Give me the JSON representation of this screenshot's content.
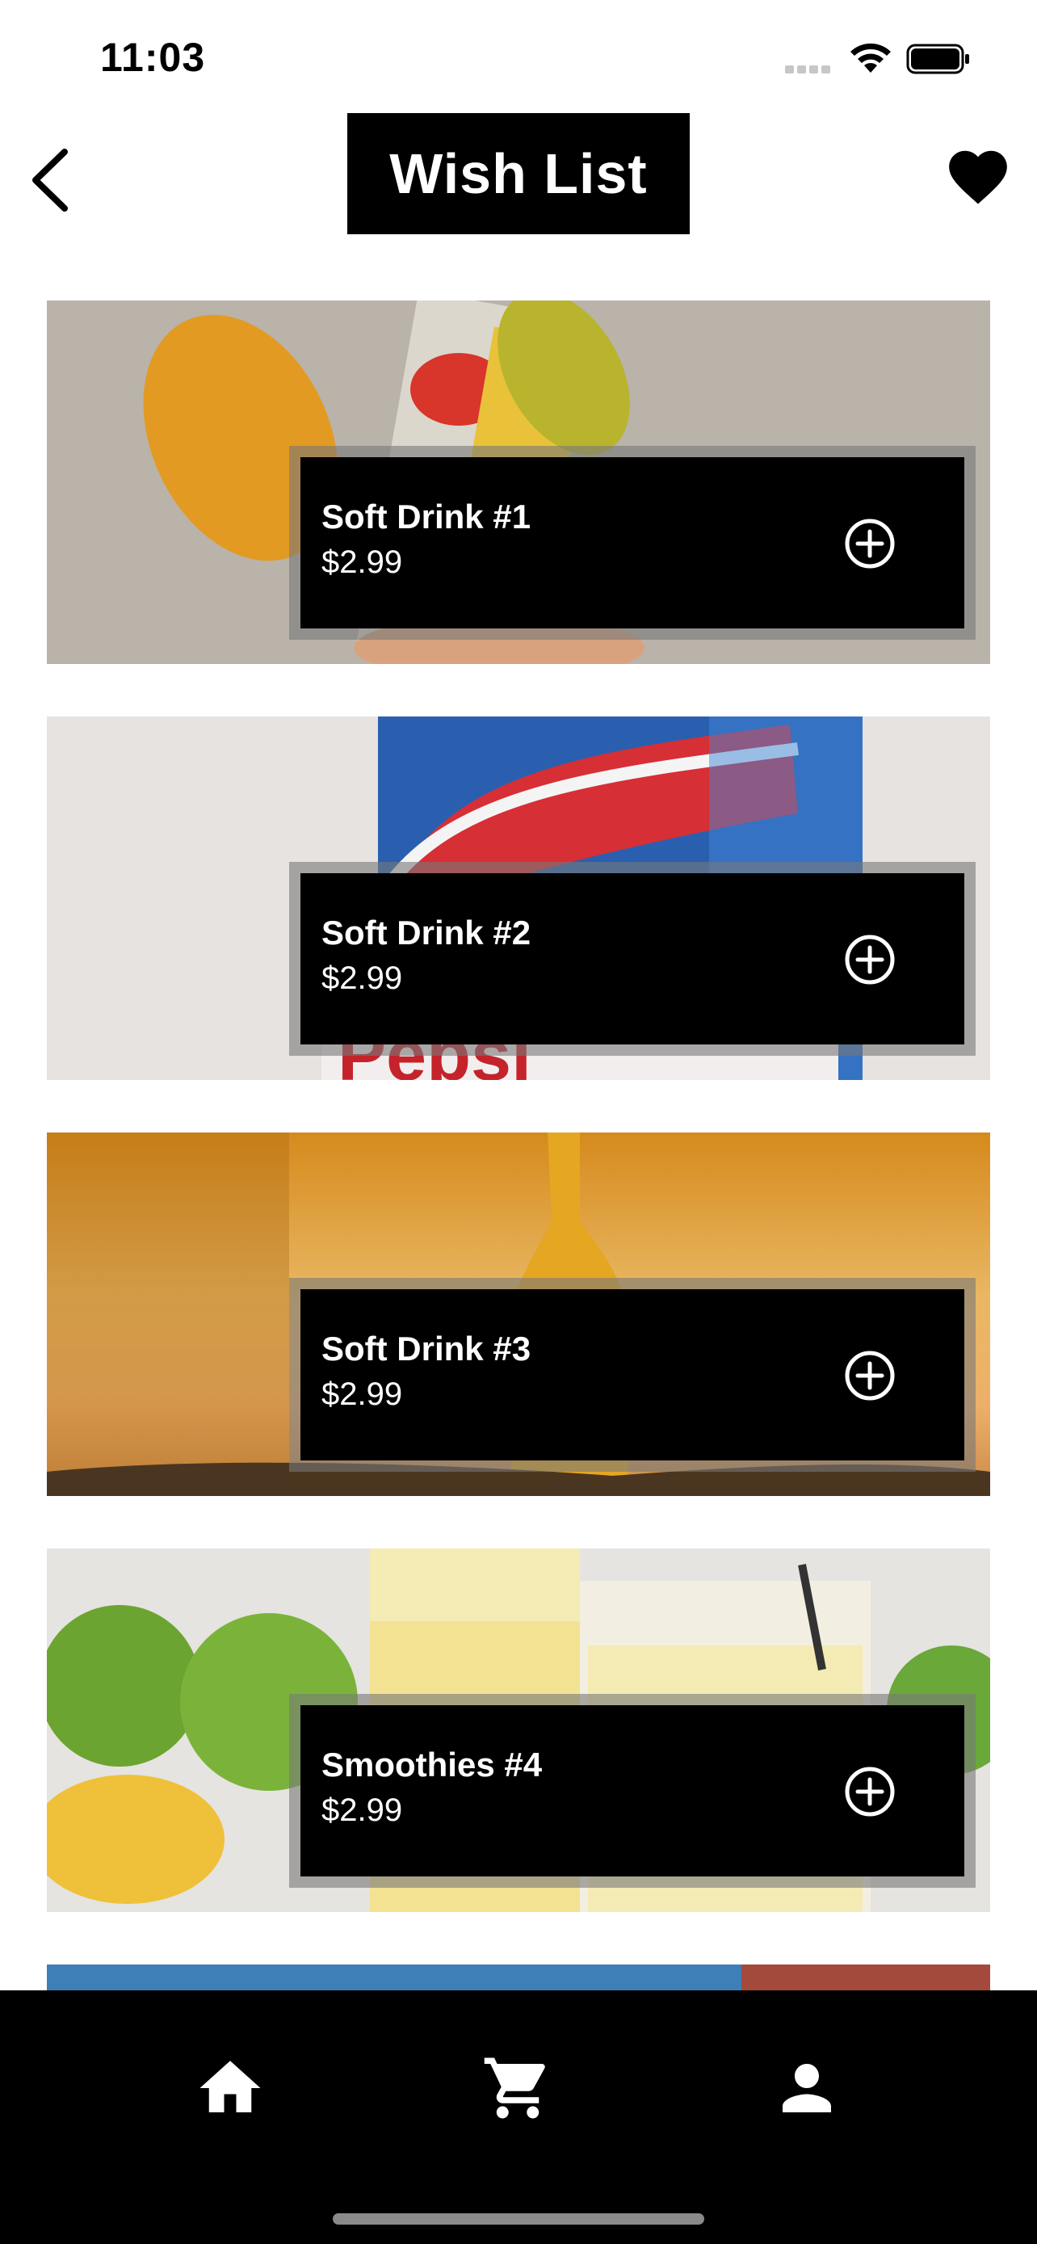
{
  "status_bar": {
    "time": "11:03"
  },
  "header": {
    "title": "Wish List"
  },
  "items": [
    {
      "name": "Soft Drink #1",
      "price": "$2.99"
    },
    {
      "name": "Soft Drink #2",
      "price": "$2.99"
    },
    {
      "name": "Soft Drink #3",
      "price": "$2.99"
    },
    {
      "name": "Smoothies #4",
      "price": "$2.99"
    }
  ],
  "icons": {
    "back": "chevron-left-icon",
    "wishlist": "heart-icon",
    "add": "plus-circle-icon",
    "tab_home": "home-icon",
    "tab_cart": "cart-icon",
    "tab_profile": "person-icon"
  },
  "colors": {
    "accent": "#000000",
    "background": "#ffffff",
    "text_on_dark": "#ffffff"
  }
}
